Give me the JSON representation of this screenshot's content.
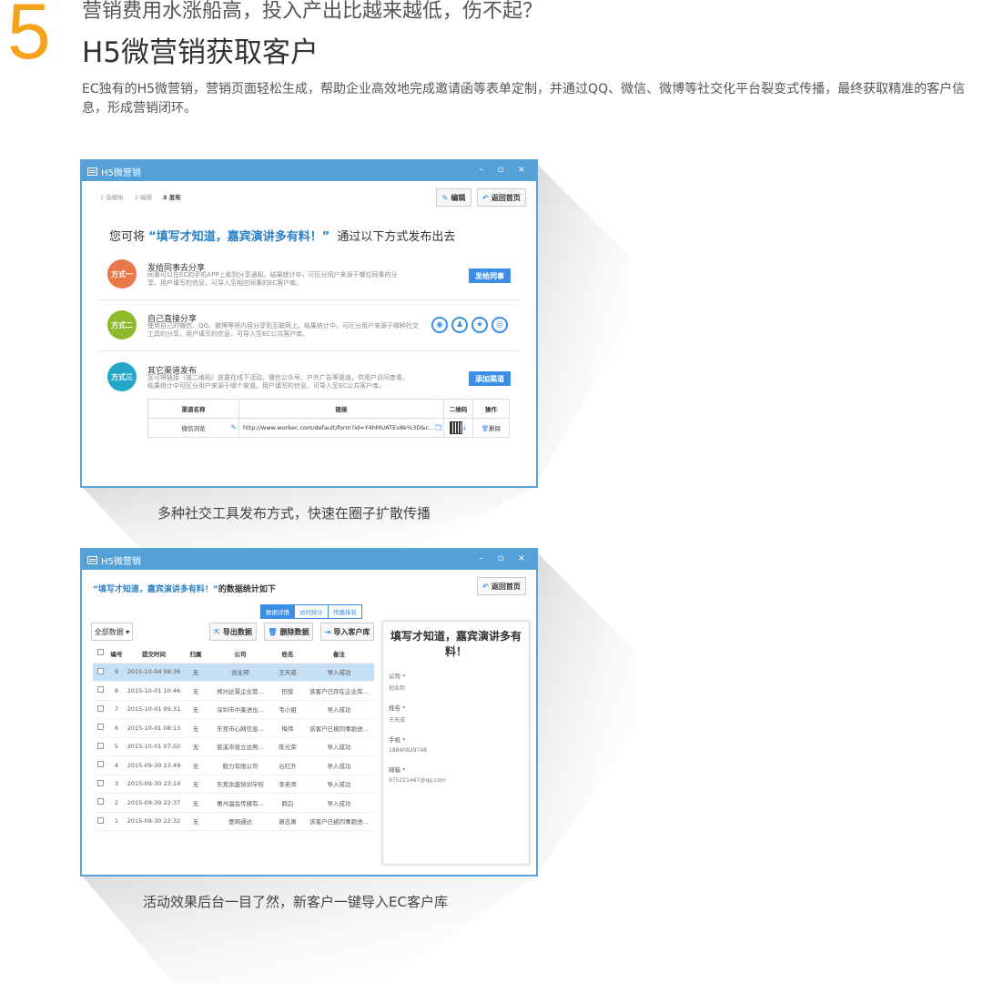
{
  "section_number": "5",
  "subtitle": "营销费用水涨船高，投入产出比越来越低，伤不起？",
  "title": "H5微营销获取客户",
  "description": "EC独有的H5微营销，营销页面轻松生成，帮助企业高效地完成邀请函等表单定制，并通过QQ、微信、微博等社交化平台裂变式传播，最终获取精准的客户信息，形成营销闭环。",
  "colors": {
    "accent": "#f7a21b",
    "window_blue": "#54a1d8",
    "button_blue": "#3a8ee6"
  },
  "window1": {
    "title": "H5微营销",
    "controls": "– ▫ ×",
    "steps": [
      "1 选模板",
      "2 编辑",
      "3 发布"
    ],
    "edit_btn": "编辑",
    "back_btn": "返回首页",
    "headline_pre": "您可将",
    "headline_name": "“填写才知道，嘉宾演讲多有料！”",
    "headline_post": "通过以下方式发布出去",
    "methods": [
      {
        "badge": "方式一",
        "color": "#e8784a",
        "title": "发给同事去分享",
        "desc": "同事可以在EC的手机APP上收到分享通知。结果统计中，可区分用户来源于哪位同事的分享。用户填写的信息，可导入至相应同事的EC客户库。",
        "action": "发给同事"
      },
      {
        "badge": "方式二",
        "color": "#8dba2a",
        "title": "自己直接分享",
        "desc": "使用自己的微信、QQ、微博等将内容分享到互联网上。结果统计中，可区分用户来源于哪种社交工具的分享。用户填写的信息，可导入至EC公共客户库。",
        "icons": [
          "wechat-icon",
          "qq-icon",
          "qzone-icon",
          "weibo-icon"
        ]
      },
      {
        "badge": "方式三",
        "color": "#22a7c8",
        "title": "其它渠道发布",
        "desc": "您可将链接（或二维码）放置在线下活动、微信公众号、户外广告等渠道，供用户访问查看。结果统计中可区分用户来源于哪个渠道。用户填写的信息，可导入至EC公共客户库。",
        "action": "添加渠道"
      }
    ],
    "channel_table": {
      "headers": [
        "渠道名称",
        "链接",
        "二维码",
        "操作"
      ],
      "row": {
        "name": "微信浏览",
        "link": "http://www.workec.com/default/form?id=Y4hMUATEv8k%3D&c...",
        "op": "删除"
      }
    }
  },
  "caption1": "多种社交工具发布方式，快速在圈子扩散传播",
  "window2": {
    "title": "H5微营销",
    "controls": "– ▫ ×",
    "heading_name": "“填写才知道，嘉宾演讲多有料！”",
    "heading_post": "的数据统计如下",
    "back_btn": "返回首页",
    "tabs": [
      "数据详情",
      "访问统计",
      "传播排名"
    ],
    "filter": "全部数据 ▾",
    "export_btn": "导出数据",
    "delete_btn": "删除数据",
    "import_btn": "导入客户库",
    "headers": [
      "编号",
      "提交时间",
      "归属",
      "公司",
      "姓名",
      "备注"
    ],
    "rows": [
      {
        "no": "9",
        "time": "2015-10-04 09:36",
        "owner": "无",
        "company": "创业邦",
        "name": "王天成",
        "note": "导入成功",
        "status": "ok"
      },
      {
        "no": "8",
        "time": "2015-10-01 10:46",
        "owner": "无",
        "company": "郑州达慧企业管...",
        "name": "田俊",
        "note": "该客户已存在企业库...",
        "status": "warn"
      },
      {
        "no": "7",
        "time": "2015-10-01 09:31",
        "owner": "无",
        "company": "深圳市中墨进出...",
        "name": "韦小姐",
        "note": "导入成功",
        "status": "ok"
      },
      {
        "no": "6",
        "time": "2015-10-01 08:13",
        "owner": "无",
        "company": "东莞市心网信息...",
        "name": "梅伟",
        "note": "该客户已被同事跟进...",
        "status": "warn"
      },
      {
        "no": "5",
        "time": "2015-10-01 07:02",
        "owner": "无",
        "company": "慈溪市俊立达照...",
        "name": "陈光荣",
        "note": "导入成功",
        "status": "ok"
      },
      {
        "no": "4",
        "time": "2015-09-30 23:49",
        "owner": "无",
        "company": "毅力有限公司",
        "name": "谷红升",
        "note": "导入成功",
        "status": "ok"
      },
      {
        "no": "3",
        "time": "2015-09-30 23:14",
        "owner": "无",
        "company": "东莞余盛培训学校",
        "name": "李老师",
        "note": "导入成功",
        "status": "ok"
      },
      {
        "no": "2",
        "time": "2015-09-30 22:37",
        "owner": "无",
        "company": "惠州温会传媒有...",
        "name": "鹤白",
        "note": "导入成功",
        "status": "ok"
      },
      {
        "no": "1",
        "time": "2015-09-30 22:32",
        "owner": "无",
        "company": "壹网通达",
        "name": "谢志勇",
        "note": "该客户已被同事跟进...",
        "status": "warn"
      }
    ],
    "detail": {
      "title": "填写才知道，嘉宾演讲多有料！",
      "fields": [
        {
          "label": "公司 *",
          "value": "创业邦"
        },
        {
          "label": "姓名 *",
          "value": "王天成"
        },
        {
          "label": "手机 *",
          "value": "18840829748"
        },
        {
          "label": "邮箱 *",
          "value": "975221467@qq.com"
        }
      ]
    }
  },
  "caption2": "活动效果后台一目了然，新客户一键导入EC客户库"
}
